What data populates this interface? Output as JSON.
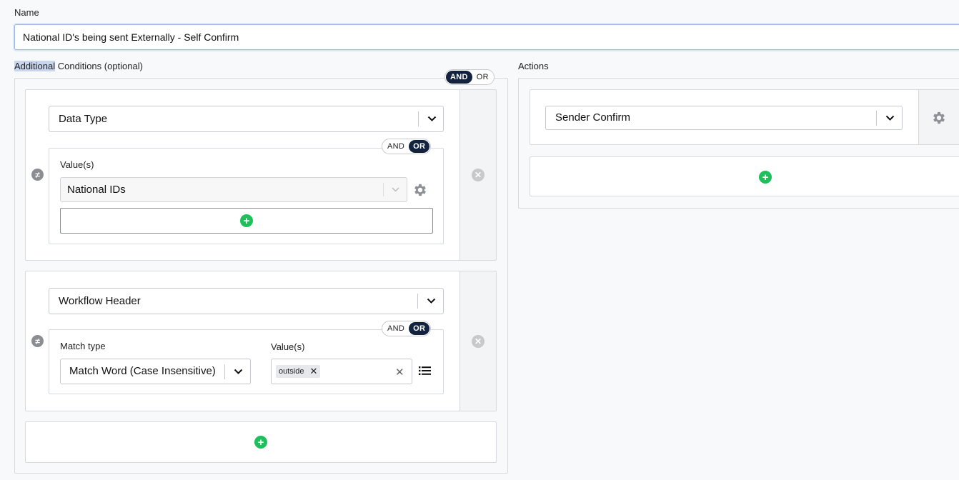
{
  "name_field": {
    "label": "Name",
    "value": "National ID's being sent Externally - Self Confirm"
  },
  "conditions": {
    "label_highlight": "Additional",
    "label_rest": " Conditions (optional)",
    "top_toggle": {
      "and": "AND",
      "or": "OR",
      "selected": "AND"
    },
    "blocks": [
      {
        "type_select": "Data Type",
        "toggle": {
          "and": "AND",
          "or": "OR",
          "selected": "OR"
        },
        "values_label": "Value(s)",
        "value_select": "National IDs"
      },
      {
        "type_select": "Workflow Header",
        "toggle": {
          "and": "AND",
          "or": "OR",
          "selected": "OR"
        },
        "match_type_label": "Match type",
        "match_type_value": "Match Word (Case Insensitive)",
        "values_label": "Value(s)",
        "tag": "outside"
      }
    ]
  },
  "actions": {
    "label": "Actions",
    "action_select": "Sender Confirm"
  },
  "icons": {
    "chevron": "chevron-down-icon",
    "gear": "gear-icon",
    "plus": "plus-circle-icon",
    "remove": "close-circle-icon",
    "not_equal": "not-equal-icon",
    "list": "list-icon"
  },
  "colors": {
    "accent_dark": "#13223f",
    "add_green": "#1fbf5c",
    "border": "#d6d9de"
  }
}
